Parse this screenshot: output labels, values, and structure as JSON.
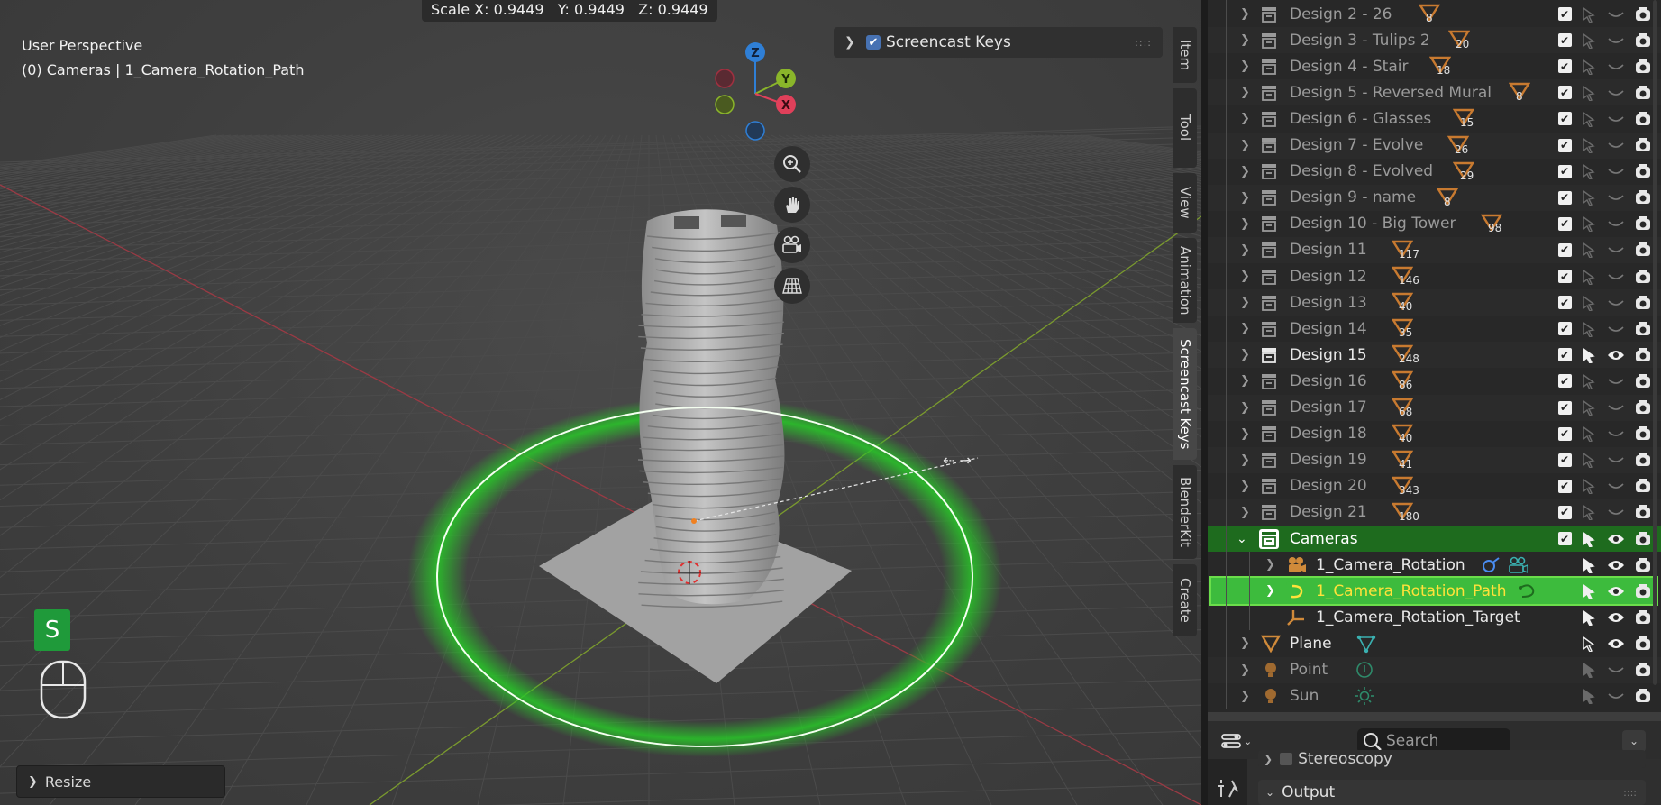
{
  "viewport": {
    "perspective_label": "User Perspective",
    "selection_label": "(0) Cameras | 1_Camera_Rotation_Path",
    "scale_readout": "Scale X: 0.9449   Y: 0.9449   Z: 0.9449",
    "gizmo": {
      "z_label": "Z",
      "y_label": "Y",
      "x_label": "X",
      "colors": {
        "x": "#e0405a",
        "y": "#8ab52a",
        "z": "#2f7fd6"
      }
    },
    "nav_icons": [
      "zoom-icon",
      "hand-icon",
      "camera-icon",
      "grid-icon"
    ],
    "key_display": "S",
    "resize_label": "Resize",
    "screencast_panel_label": "Screencast Keys",
    "accent_color": "#1f9a3a"
  },
  "side_tabs": [
    "Item",
    "Tool",
    "View",
    "Animation",
    "Screencast Keys",
    "BlenderKit",
    "Create"
  ],
  "outliner": {
    "rows": [
      {
        "label": "Design 2 - 26",
        "count": "8"
      },
      {
        "label": "Design 3 - Tulips 2",
        "count": "20"
      },
      {
        "label": "Design 4 - Stair",
        "count": "18"
      },
      {
        "label": "Design 5 - Reversed Mural",
        "count": "8"
      },
      {
        "label": "Design 6 - Glasses",
        "count": "15"
      },
      {
        "label": "Design 7 - Evolve",
        "count": "26"
      },
      {
        "label": "Design 8 - Evolved",
        "count": "29"
      },
      {
        "label": "Design 9 - name",
        "count": "8"
      },
      {
        "label": "Design 10 - Big Tower",
        "count": "98"
      },
      {
        "label": "Design 11",
        "count": "117"
      },
      {
        "label": "Design 12",
        "count": "146"
      },
      {
        "label": "Design 13",
        "count": "40"
      },
      {
        "label": "Design 14",
        "count": "35"
      },
      {
        "label": "Design 15",
        "count": "248"
      },
      {
        "label": "Design 16",
        "count": "86"
      },
      {
        "label": "Design 17",
        "count": "68"
      },
      {
        "label": "Design 18",
        "count": "40"
      },
      {
        "label": "Design 19",
        "count": "41"
      },
      {
        "label": "Design 20",
        "count": "343"
      },
      {
        "label": "Design 21",
        "count": "180"
      }
    ],
    "cameras_collection": "Cameras",
    "camera_children": [
      "1_Camera_Rotation",
      "1_Camera_Rotation_Path",
      "1_Camera_Rotation_Target"
    ],
    "scene_objects": [
      "Plane",
      "Point",
      "Sun"
    ]
  },
  "properties": {
    "search_placeholder": "Search",
    "stereoscopy_label": "Stereoscopy",
    "output_label": "Output"
  }
}
